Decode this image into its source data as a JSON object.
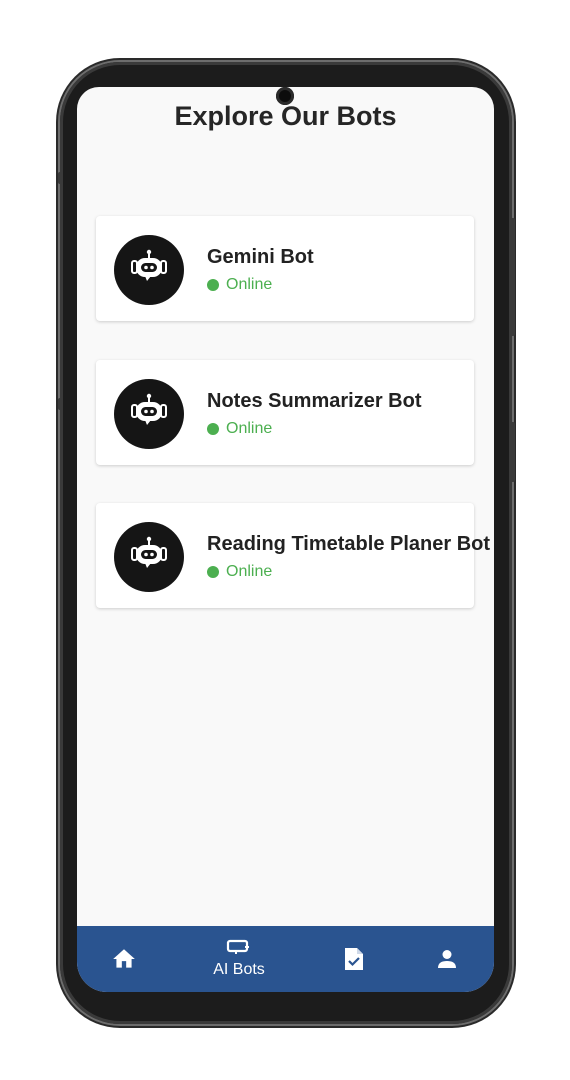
{
  "page": {
    "title": "Explore Our Bots"
  },
  "bots": [
    {
      "name": "Gemini Bot",
      "status": "Online"
    },
    {
      "name": "Notes Summarizer Bot",
      "status": "Online"
    },
    {
      "name": "Reading Timetable Planer Bot",
      "status": "Online"
    }
  ],
  "nav": {
    "items": [
      {
        "icon": "home-icon",
        "label": ""
      },
      {
        "icon": "ai-bots-icon",
        "label": "AI Bots"
      },
      {
        "icon": "task-document-icon",
        "label": ""
      },
      {
        "icon": "profile-icon",
        "label": ""
      }
    ],
    "active_index": 1
  },
  "colors": {
    "status_online": "#4caf50",
    "nav_background": "#2a5490",
    "avatar_background": "#151515",
    "screen_background": "#f9f9f9"
  }
}
